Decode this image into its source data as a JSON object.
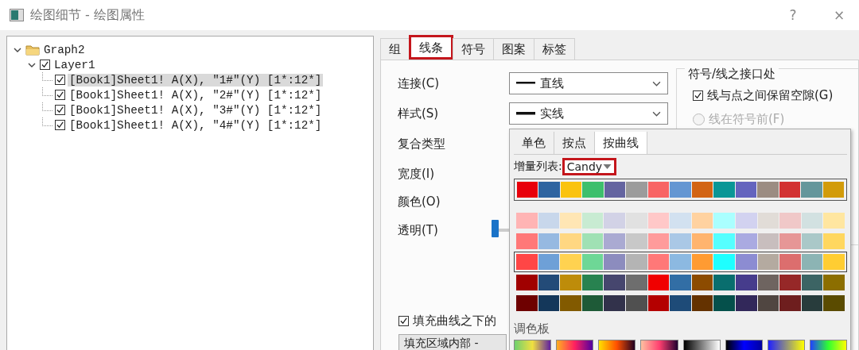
{
  "window": {
    "title": "绘图细节 - 绘图属性",
    "help": "?",
    "close": "×"
  },
  "tree": [
    {
      "label": "Graph2",
      "expanded": true,
      "children": [
        {
          "label": "Layer1",
          "expanded": true,
          "checked": true,
          "children": [
            {
              "label": "[Book1]Sheet1! A(X), \"1#\"(Y) [1*:12*]",
              "checked": true,
              "selected": true
            },
            {
              "label": "[Book1]Sheet1! A(X), \"2#\"(Y) [1*:12*]",
              "checked": true,
              "selected": false
            },
            {
              "label": "[Book1]Sheet1! A(X), \"3#\"(Y) [1*:12*]",
              "checked": true,
              "selected": false
            },
            {
              "label": "[Book1]Sheet1! A(X), \"4#\"(Y) [1*:12*]",
              "checked": true,
              "selected": false
            }
          ]
        }
      ]
    }
  ],
  "tabs": [
    {
      "label": "组",
      "selected": false,
      "highlighted": false
    },
    {
      "label": "线条",
      "selected": true,
      "highlighted": true
    },
    {
      "label": "符号",
      "selected": false,
      "highlighted": false
    },
    {
      "label": "图案",
      "selected": false,
      "highlighted": false
    },
    {
      "label": "标签",
      "selected": false,
      "highlighted": false
    }
  ],
  "form": [
    {
      "label": "连接(C)",
      "kind": "dropdown",
      "value": "直线"
    },
    {
      "label": "样式(S)",
      "kind": "dropdown",
      "value": "实线"
    },
    {
      "label": "复合类型",
      "kind": "plain"
    },
    {
      "label": "宽度(I)",
      "kind": "plain"
    },
    {
      "label": "颜色(O)",
      "kind": "plain"
    },
    {
      "label": "透明(T)",
      "kind": "slider",
      "level": 0
    }
  ],
  "gap_group": {
    "title": "符号/线之接口处",
    "options": [
      {
        "kind": "checkbox",
        "label": "线与点之间保留空隙(G)",
        "checked": true,
        "disabled": false
      },
      {
        "kind": "radio",
        "label": "线在符号前(F)",
        "checked": false,
        "disabled": true
      }
    ]
  },
  "fill": {
    "label": "填充曲线之下的",
    "checked": true,
    "field_value": "填充区域内部 -"
  },
  "popup": {
    "tabs": [
      {
        "label": "单色",
        "selected": false
      },
      {
        "label": "按点",
        "selected": false
      },
      {
        "label": "按曲线",
        "selected": true
      }
    ],
    "increment_label": "增量列表:",
    "increment_value": "Candy",
    "increment_highlighted": true,
    "current": [
      {
        "color": "#e8000b"
      },
      {
        "color": "#2e64a0"
      },
      {
        "color": "#fac30f"
      },
      {
        "color": "#3dbf6c"
      },
      {
        "color": "#6464a0"
      },
      {
        "color": "#9b9b9b"
      },
      {
        "color": "#f86464"
      },
      {
        "color": "#6496d2"
      },
      {
        "color": "#d26414"
      },
      {
        "color": "#0a9696"
      },
      {
        "color": "#6464be"
      },
      {
        "color": "#9b8c82"
      },
      {
        "color": "#d23232"
      },
      {
        "color": "#64969b"
      },
      {
        "color": "#d29b0a"
      }
    ],
    "lists": [
      {
        "selected": false,
        "colors": [
          {
            "color": "#ffb4b4"
          },
          {
            "color": "#c8d7eb"
          },
          {
            "color": "#ffe6b4"
          },
          {
            "color": "#c8ebd2"
          },
          {
            "color": "#d2d2e6"
          },
          {
            "color": "#e1e1e1"
          },
          {
            "color": "#ffc8c8"
          },
          {
            "color": "#d2e1f0"
          },
          {
            "color": "#ffd2a0"
          },
          {
            "color": "#aaffff"
          },
          {
            "color": "#d2d2f0"
          },
          {
            "color": "#e1dcd7"
          },
          {
            "color": "#f0c8c8"
          },
          {
            "color": "#d2e1e1"
          },
          {
            "color": "#ffe6a0"
          }
        ]
      },
      {
        "selected": false,
        "colors": [
          {
            "color": "#ff7878"
          },
          {
            "color": "#96b9e1"
          },
          {
            "color": "#ffd782"
          },
          {
            "color": "#a0e1b4"
          },
          {
            "color": "#aaaad2"
          },
          {
            "color": "#c8c8c8"
          },
          {
            "color": "#ff9b9b"
          },
          {
            "color": "#aac8e6"
          },
          {
            "color": "#ffb46e"
          },
          {
            "color": "#55ffff"
          },
          {
            "color": "#aaaae1"
          },
          {
            "color": "#c8bebe"
          },
          {
            "color": "#e69696"
          },
          {
            "color": "#aac8c8"
          },
          {
            "color": "#ffd75f"
          }
        ]
      },
      {
        "selected": true,
        "colors": [
          {
            "color": "#ff4646"
          },
          {
            "color": "#6ea0d7"
          },
          {
            "color": "#ffd250"
          },
          {
            "color": "#6ed796"
          },
          {
            "color": "#8c8cbe"
          },
          {
            "color": "#b4b4b4"
          },
          {
            "color": "#ff7878"
          },
          {
            "color": "#8cb9e1"
          },
          {
            "color": "#ff9b32"
          },
          {
            "color": "#1effff"
          },
          {
            "color": "#8c8cd2"
          },
          {
            "color": "#b4aaa0"
          },
          {
            "color": "#dc6e6e"
          },
          {
            "color": "#8cb4b4"
          },
          {
            "color": "#ffcd32"
          }
        ]
      },
      {
        "selected": false,
        "colors": [
          {
            "color": "#a00000"
          },
          {
            "color": "#234b78"
          },
          {
            "color": "#be8c0a"
          },
          {
            "color": "#288250"
          },
          {
            "color": "#46466e"
          },
          {
            "color": "#6e6e6e"
          },
          {
            "color": "#f00000"
          },
          {
            "color": "#326ea5"
          },
          {
            "color": "#8c4b00"
          },
          {
            "color": "#096e6e"
          },
          {
            "color": "#463c8c"
          },
          {
            "color": "#6e6460"
          },
          {
            "color": "#962828"
          },
          {
            "color": "#3c6464"
          },
          {
            "color": "#8c6e00"
          }
        ]
      },
      {
        "selected": false,
        "colors": [
          {
            "color": "#6e0000"
          },
          {
            "color": "#14375a"
          },
          {
            "color": "#825a00"
          },
          {
            "color": "#1e5a37"
          },
          {
            "color": "#32324b"
          },
          {
            "color": "#505050"
          },
          {
            "color": "#b40000"
          },
          {
            "color": "#1e4b78"
          },
          {
            "color": "#643200"
          },
          {
            "color": "#05504b"
          },
          {
            "color": "#32285a"
          },
          {
            "color": "#504641"
          },
          {
            "color": "#6e1e1e"
          },
          {
            "color": "#283c3c"
          },
          {
            "color": "#5a4b00"
          }
        ]
      }
    ],
    "palette_label": "调色板"
  }
}
